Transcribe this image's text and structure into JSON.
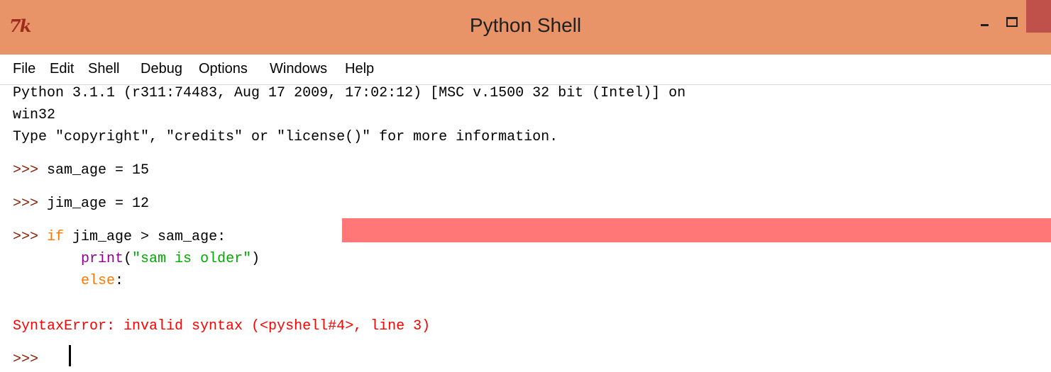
{
  "window": {
    "icon_text": "7k",
    "title": "Python Shell"
  },
  "menu": [
    "File",
    "Edit",
    "Shell",
    "Debug",
    "Options",
    "Windows",
    "Help"
  ],
  "shell": {
    "banner_line1": "Python 3.1.1 (r311:74483, Aug 17 2009, 17:02:12) [MSC v.1500 32 bit (Intel)] on",
    "banner_line2": "win32",
    "banner_line3": "Type \"copyright\", \"credits\" or \"license()\" for more information.",
    "prompt": ">>> ",
    "cmd1": "sam_age = 15",
    "cmd2": "jim_age = 12",
    "cmd3_keyword": "if",
    "cmd3_rest": " jim_age > sam_age:",
    "cmd4_indent": "        ",
    "cmd4_builtin": "print",
    "cmd4_open": "(",
    "cmd4_string": "\"sam is older\"",
    "cmd4_close": ")",
    "cmd5_indent": "        ",
    "cmd5_keyword": "else",
    "cmd5_colon": ":",
    "error": "SyntaxError: invalid syntax (<pyshell#4>, line 3)",
    "final_prompt": ">>> "
  },
  "colors": {
    "titlebar": "#e89468",
    "close_button": "#c0504a",
    "prompt": "#8b1a00",
    "keyword": "#ff7700",
    "builtin": "#900090",
    "string": "#00aa00",
    "error": "#ff0000",
    "error_highlight": "#ff7777"
  }
}
